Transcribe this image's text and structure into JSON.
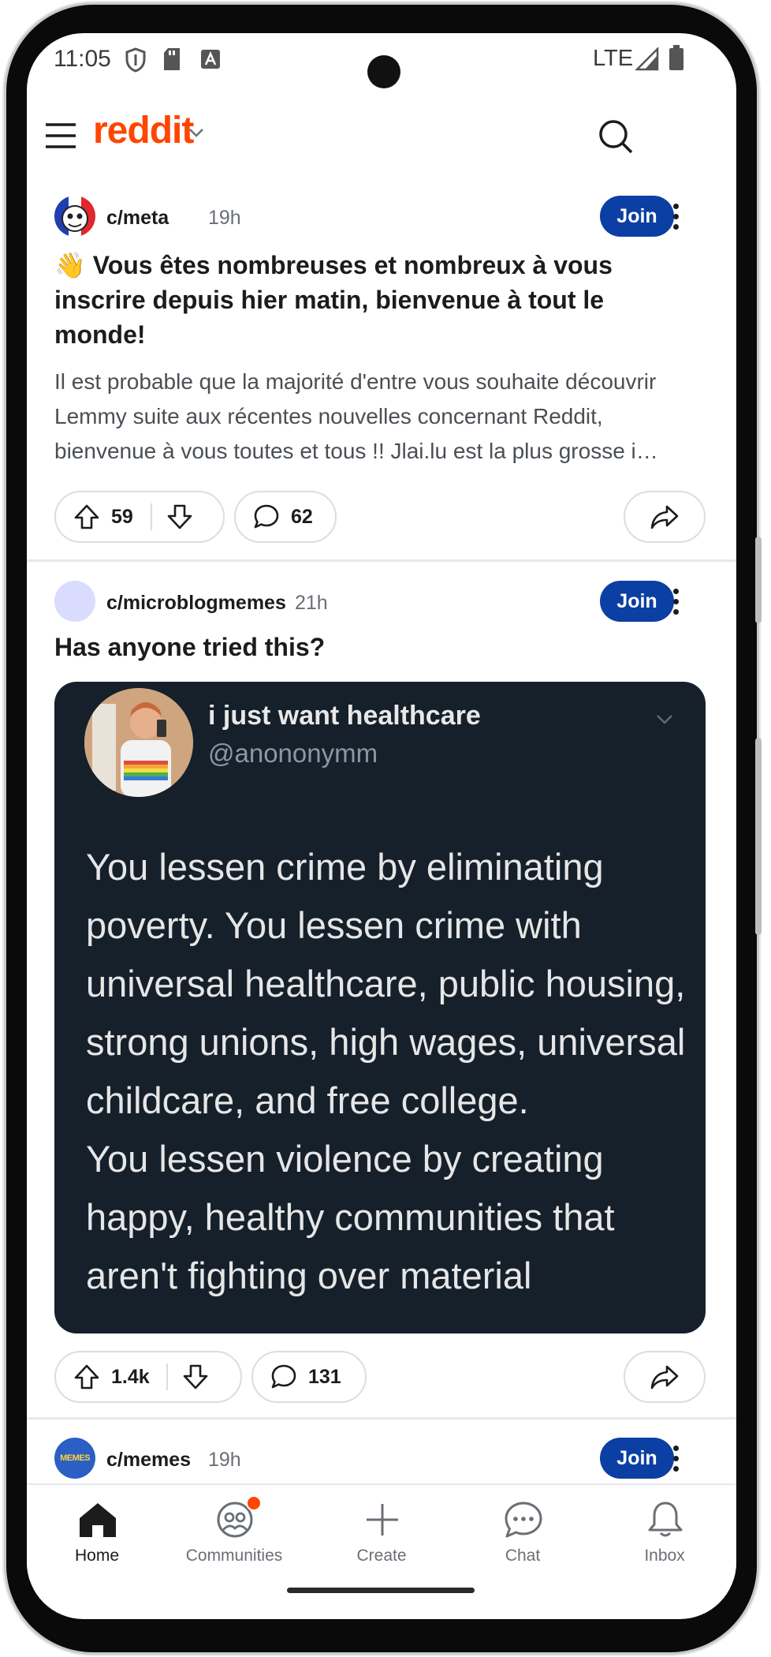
{
  "status_bar": {
    "time": "11:05",
    "network": "LTE"
  },
  "header": {
    "logo": "reddit",
    "logo_color": "#ff4500",
    "menu_icon": "hamburger-menu-icon",
    "search_icon": "search-icon"
  },
  "posts": [
    {
      "subreddit": "c/meta",
      "time": "19h",
      "join_label": "Join",
      "title": "👋 Vous êtes nombreuses et nombreux à vous inscrire depuis hier matin, bienvenue à tout le monde!",
      "body": "Il est probable que la majorité d'entre vous souhaite découvrir Lemmy suite aux récentes nouvelles concernant Reddit, bienvenue à vous toutes et tous !! Jlai.lu est la plus grosse i…",
      "upvotes": "59",
      "comments": "62"
    },
    {
      "subreddit": "c/microblogmemes",
      "time": "21h",
      "join_label": "Join",
      "title": "Has anyone tried this?",
      "image": {
        "name": "i just want healthcare",
        "handle": "@anononymm",
        "text": "You lessen crime by eliminating poverty. You lessen crime with universal healthcare, public housing, strong unions, high wages, universal childcare, and free college.\nYou lessen violence by creating happy, healthy communities that aren't fighting over material"
      },
      "upvotes": "1.4k",
      "comments": "131"
    },
    {
      "subreddit": "c/memes",
      "time": "19h",
      "join_label": "Join",
      "avatar_text": "MEMES"
    }
  ],
  "bottom_nav": [
    {
      "label": "Home",
      "icon": "home-icon",
      "active": true
    },
    {
      "label": "Communities",
      "icon": "communities-icon",
      "badge": true
    },
    {
      "label": "Create",
      "icon": "plus-icon"
    },
    {
      "label": "Chat",
      "icon": "chat-icon"
    },
    {
      "label": "Inbox",
      "icon": "bell-icon"
    }
  ],
  "colors": {
    "join_button": "#0b3fa3",
    "tweet_background": "#15202b",
    "badge": "#ff4500"
  }
}
